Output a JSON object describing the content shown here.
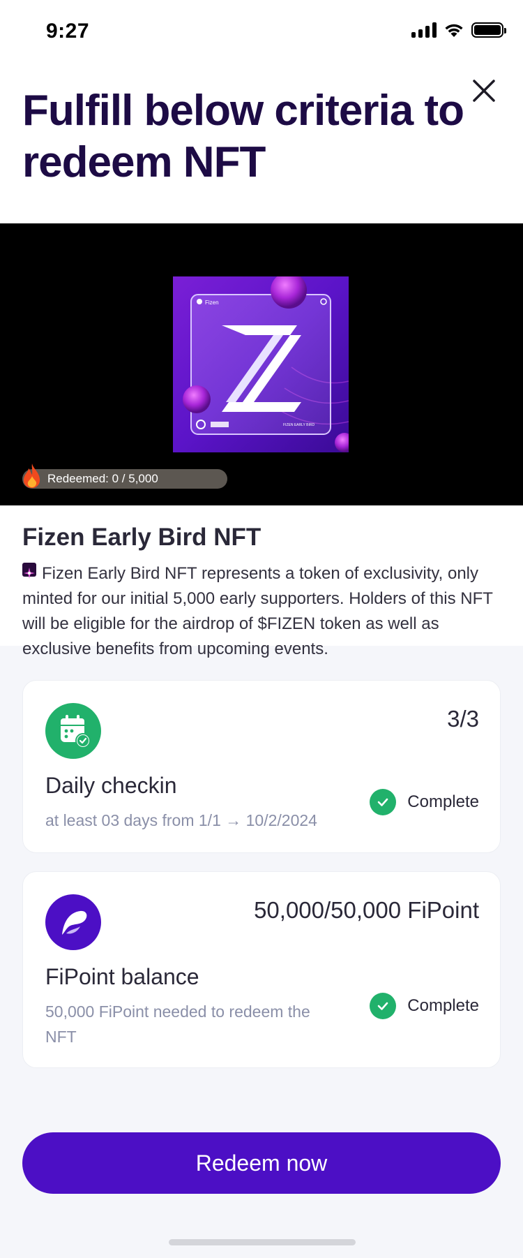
{
  "status_bar": {
    "time": "9:27"
  },
  "header": {
    "title": "Fulfill below criteria to redeem NFT"
  },
  "nft": {
    "redeemed_label": "Redeemed: 0 / 5,000",
    "art_brand": "Fizen",
    "art_caption": "FIZEN EARLY BIRD",
    "name": "Fizen Early Bird NFT",
    "description": "Fizen Early Bird NFT represents a token of exclusivity, only minted for our initial 5,000 early supporters. Holders of this NFT will be eligible for the airdrop of $FIZEN token as well as exclusive benefits from upcoming events."
  },
  "criteria": [
    {
      "icon": "calendar-check-icon",
      "progress": "3/3",
      "title": "Daily checkin",
      "subtitle": "at least 03 days from 1/1 → 10/2/2024",
      "status": "Complete"
    },
    {
      "icon": "fipoint-logo-icon",
      "progress": "50,000/50,000 FiPoint",
      "title": "FiPoint balance",
      "subtitle": "50,000 FiPoint needed to redeem the NFT",
      "status": "Complete"
    }
  ],
  "colors": {
    "primary": "#4c0fc5",
    "success": "#21b16b",
    "title": "#1d0b45",
    "muted": "#8a8fa8"
  },
  "cta": {
    "label": "Redeem now"
  }
}
